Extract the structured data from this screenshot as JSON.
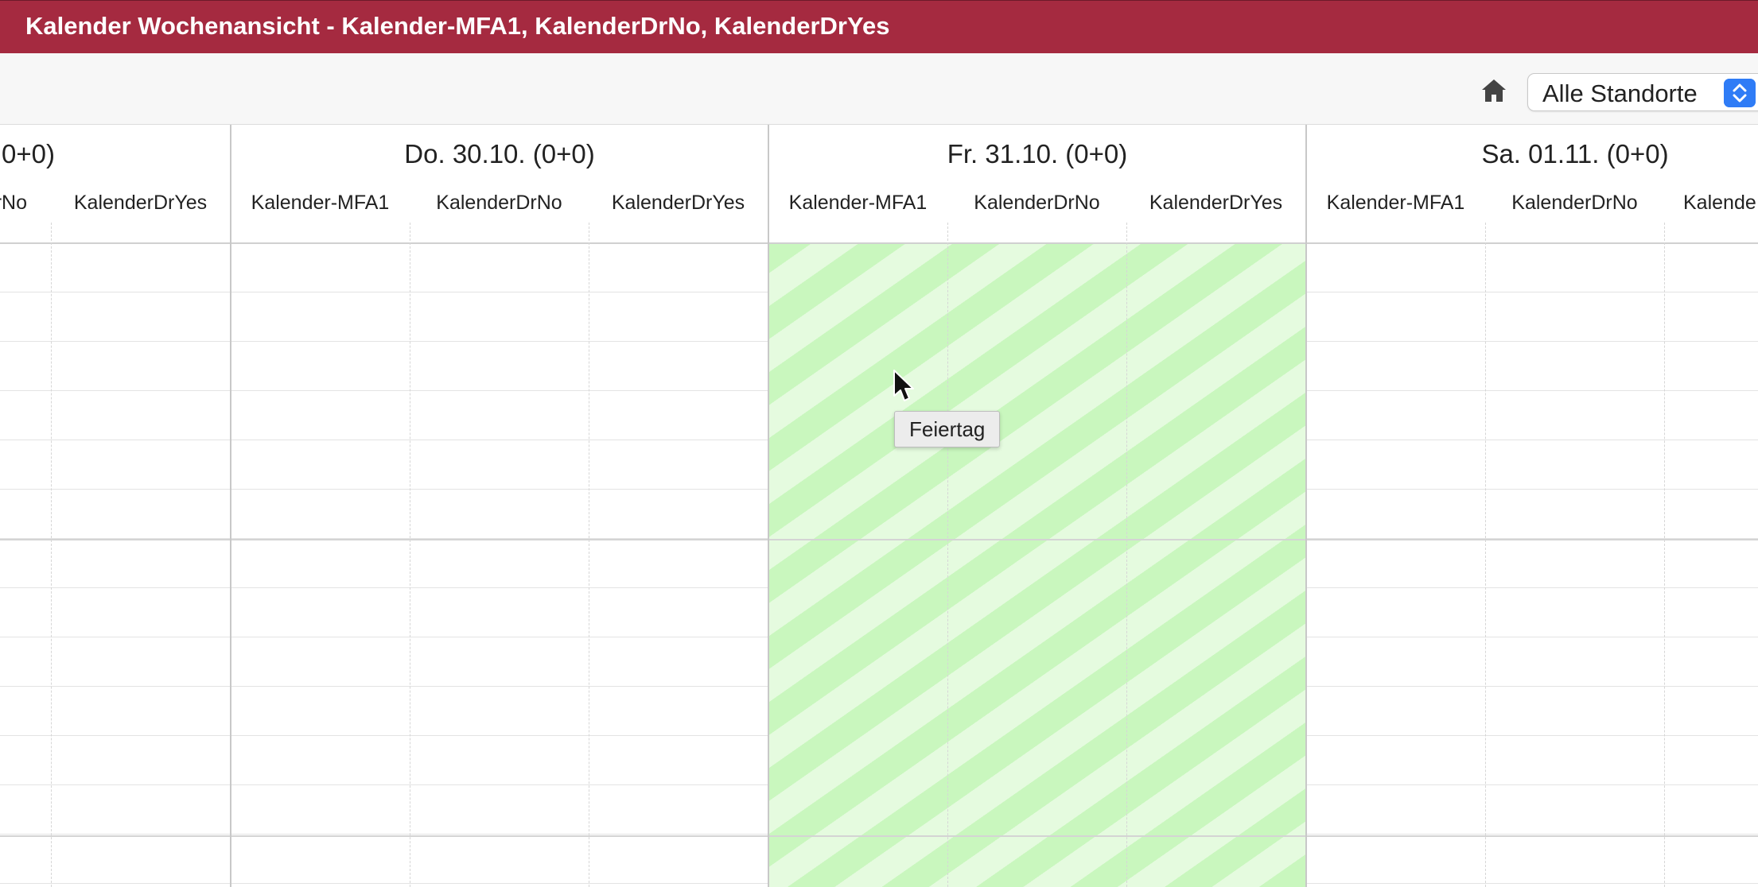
{
  "window": {
    "title": "Kalender Wochenansicht - Kalender-MFA1, KalenderDrNo, KalenderDrYes"
  },
  "toolbar": {
    "home_icon": "home-icon",
    "location_select": {
      "value": "Alle Standorte"
    }
  },
  "calendar": {
    "days": [
      {
        "label": "0+0)",
        "resources": [
          "rNo",
          "KalenderDrYes"
        ]
      },
      {
        "label": "Do. 30.10. (0+0)",
        "resources": [
          "Kalender-MFA1",
          "KalenderDrNo",
          "KalenderDrYes"
        ]
      },
      {
        "label": "Fr. 31.10. (0+0)",
        "holiday": true,
        "resources": [
          "Kalender-MFA1",
          "KalenderDrNo",
          "KalenderDrYes"
        ]
      },
      {
        "label": "Sa. 01.11. (0+0)",
        "resources": [
          "Kalender-MFA1",
          "KalenderDrNo",
          "Kalende"
        ]
      }
    ],
    "holiday_color": "#c9f7be"
  },
  "tooltip": {
    "text": "Feiertag"
  },
  "colors": {
    "titlebar": "#a52a40",
    "select_accent": "#2f7cf6"
  }
}
